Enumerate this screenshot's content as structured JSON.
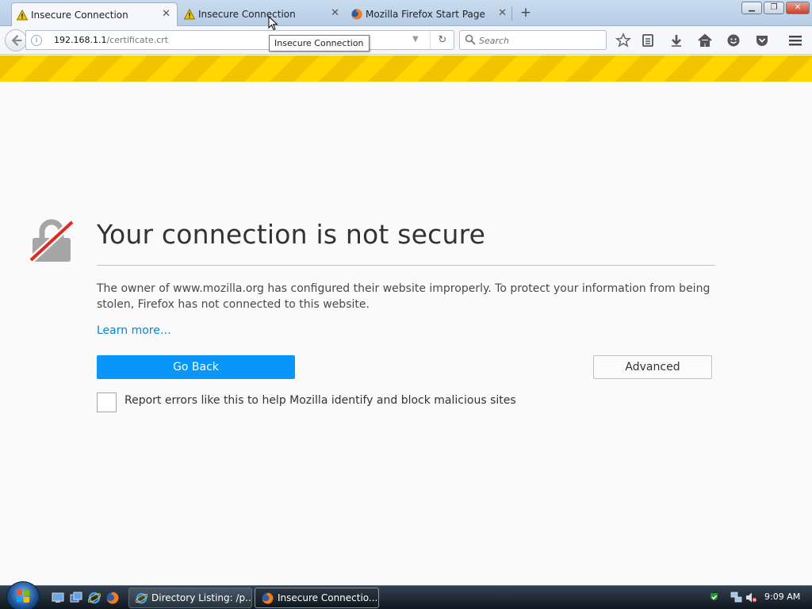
{
  "browser": {
    "tabs": [
      {
        "title": "Insecure Connection",
        "icon": "warning-icon",
        "active": true
      },
      {
        "title": "Insecure Connection",
        "icon": "warning-icon",
        "active": false
      },
      {
        "title": "Mozilla Firefox Start Page",
        "icon": "firefox-icon",
        "active": false
      }
    ],
    "new_tab_label": "+",
    "url": {
      "host": "192.168.1.1",
      "path": "/certificate.crt"
    },
    "search_placeholder": "Search",
    "tooltip": "Insecure Connection",
    "toolbar_icons": [
      "bookmark-star-icon",
      "reading-list-icon",
      "downloads-icon",
      "home-icon",
      "hello-icon",
      "pocket-icon",
      "menu-icon"
    ]
  },
  "error_page": {
    "title": "Your connection is not secure",
    "description": "The owner of www.mozilla.org has configured their website improperly. To protect your information from being stolen, Firefox has not connected to this website.",
    "learn_more": "Learn more…",
    "go_back": "Go Back",
    "advanced": "Advanced",
    "report_label": "Report errors like this to help Mozilla identify and block malicious sites",
    "report_checked": false
  },
  "taskbar": {
    "buttons": [
      {
        "label": "Directory Listing: /p...",
        "icon": "ie-icon",
        "active": false
      },
      {
        "label": "Insecure Connectio...",
        "icon": "firefox-icon",
        "active": true
      }
    ],
    "clock": "9:09 AM"
  },
  "colors": {
    "primary_button": "#0996f8",
    "link": "#0a84d6",
    "warning_stripe": "#ffd600",
    "lock_strike": "#d92d21"
  }
}
